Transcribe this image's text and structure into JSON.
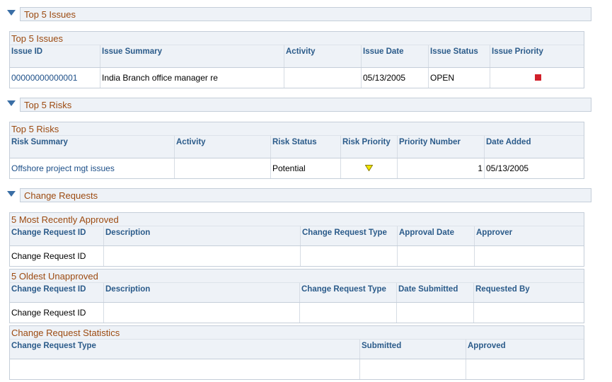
{
  "colors": {
    "section_title": "#9c4a10",
    "header_text": "#2b5b8a",
    "link": "#1d4f88",
    "priority_high": "#d1202a",
    "priority_medium": "#f2e600"
  },
  "top_issues": {
    "section_title": "Top 5 Issues",
    "grid_title": "Top 5 Issues",
    "columns": [
      "Issue ID",
      "Issue Summary",
      "Activity",
      "Issue Date",
      "Issue Status",
      "Issue Priority"
    ],
    "rows": [
      {
        "issue_id": "00000000000001",
        "summary": "India Branch office manager re",
        "activity": "",
        "date": "05/13/2005",
        "status": "OPEN",
        "priority_icon": "red-square-icon"
      }
    ]
  },
  "top_risks": {
    "section_title": "Top 5 Risks",
    "grid_title": "Top 5 Risks",
    "columns": [
      "Risk Summary",
      "Activity",
      "Risk Status",
      "Risk Priority",
      "Priority Number",
      "Date Added"
    ],
    "rows": [
      {
        "summary": "Offshore project mgt issues",
        "activity": "",
        "status": "Potential",
        "priority_icon": "yellow-triangle-icon",
        "priority_number": "1",
        "date_added": "05/13/2005"
      }
    ]
  },
  "change_requests": {
    "section_title": "Change Requests",
    "approved": {
      "grid_title": "5 Most Recently Approved",
      "columns": [
        "Change Request ID",
        "Description",
        "Change Request Type",
        "Approval Date",
        "Approver"
      ],
      "rows": [
        {
          "id": "Change Request ID",
          "description": "",
          "type": "",
          "date": "",
          "person": ""
        }
      ]
    },
    "unapproved": {
      "grid_title": "5 Oldest Unapproved",
      "columns": [
        "Change Request ID",
        "Description",
        "Change Request Type",
        "Date Submitted",
        "Requested By"
      ],
      "rows": [
        {
          "id": "Change Request ID",
          "description": "",
          "type": "",
          "date": "",
          "person": ""
        }
      ]
    },
    "statistics": {
      "grid_title": "Change Request Statistics",
      "columns": [
        "Change Request Type",
        "Submitted",
        "Approved"
      ],
      "rows": [
        {
          "type": "",
          "submitted": "",
          "approved": ""
        }
      ]
    }
  }
}
